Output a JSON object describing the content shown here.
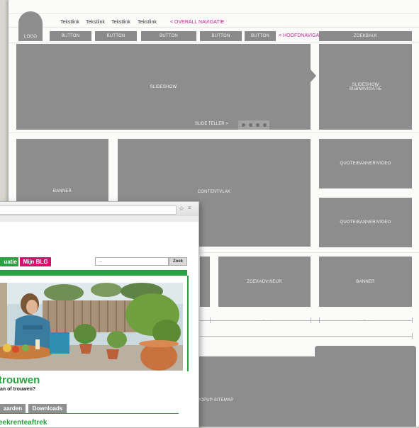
{
  "wireframe": {
    "logo": "LOGO",
    "text_links": [
      "Tekstlink",
      "Tekstlink",
      "Tekstlink",
      "Tekstlink"
    ],
    "overall_nav_note": "< OVERALL NAVIGATIE",
    "buttons": [
      "BUTTON",
      "BUTTON",
      "BUTTON",
      "BUTTON",
      "BUTTON"
    ],
    "main_nav_note": "< HOOFDNAVIGATIE",
    "search_bar": "ZOEKBALK",
    "slideshow": "SLIDESHOW",
    "slideshow_subnav": "SLIDESHOW SUBNAVIGATIE",
    "slide_counter": "SLIDE TELLER >",
    "banner_left": "BANNER",
    "content_area": "CONTENTVLAK",
    "quote_1": "QUOTE/BANNER/VIDEO",
    "quote_2": "QUOTE/BANNER/VIDEO",
    "search_advisor": "ZOEKADVISEUR",
    "banner_right": "BANNER",
    "popup_sitemap": "POPUP SITEMAP",
    "dim_labels": [
      "— 1 — —",
      "— 1 — —"
    ]
  },
  "browser": {
    "nav_green_label": "uatie",
    "nav_pink_label": "Mijn BLG",
    "search_value": "...",
    "search_button": "Zoek",
    "headline": "trouwen",
    "subline": "an of trouwen?",
    "tab_1": "aarden",
    "tab_2": "Downloads",
    "bottom_text": "eekrenteaftrek",
    "star_icon": "☆",
    "menu_icon": "≡"
  }
}
